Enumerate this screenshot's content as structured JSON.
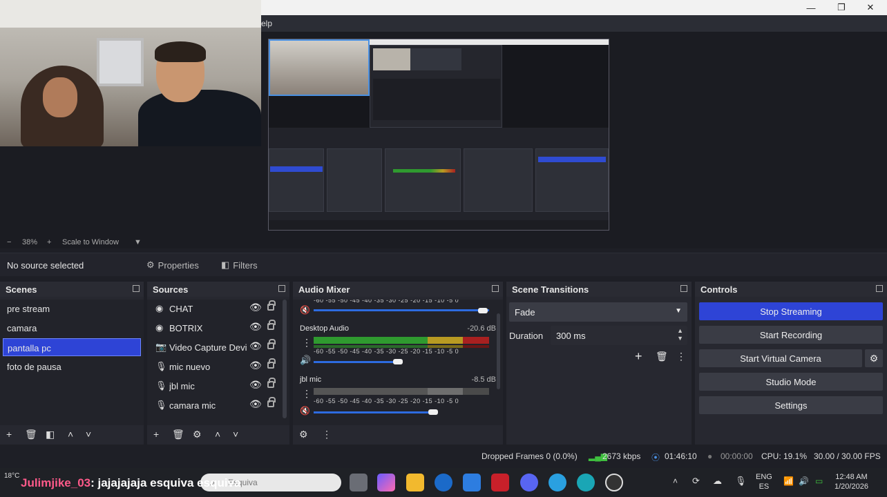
{
  "window": {
    "minimize": "—",
    "restore": "❐",
    "close": "✕",
    "menu_fragment": "elp"
  },
  "preview_toolbar": {
    "zoom_out": "−",
    "zoom": "38%",
    "zoom_in": "+",
    "scale_mode": "Scale to Window"
  },
  "source_toolbar": {
    "status": "No source selected",
    "properties": "Properties",
    "filters": "Filters"
  },
  "scenes": {
    "title": "Scenes",
    "items": [
      {
        "label": "pre stream"
      },
      {
        "label": "camara"
      },
      {
        "label": "pantalla pc"
      },
      {
        "label": "foto de pausa"
      }
    ],
    "selected": "pantalla pc"
  },
  "sources": {
    "title": "Sources",
    "items": [
      {
        "label": "CHAT",
        "icon": "browser-icon"
      },
      {
        "label": "BOTRIX",
        "icon": "browser-icon"
      },
      {
        "label": "Video Capture Device",
        "icon": "camera-icon"
      },
      {
        "label": "mic nuevo",
        "icon": "mic-icon"
      },
      {
        "label": "jbl mic",
        "icon": "mic-icon"
      },
      {
        "label": "camara mic",
        "icon": "mic-icon"
      }
    ]
  },
  "audio_mixer": {
    "title": "Audio Mixer",
    "scale": "-60 -55 -50 -45 -40 -35 -30 -25 -20 -15 -10 -5 0",
    "channels": [
      {
        "name": "Desktop Audio",
        "db": "-20.6 dB",
        "volume": 0.48
      },
      {
        "name": "jbl mic",
        "db": "-8.5 dB",
        "volume": 0.68
      }
    ]
  },
  "scene_transitions": {
    "title": "Scene Transitions",
    "transition": "Fade",
    "duration_label": "Duration",
    "duration_value": "300 ms"
  },
  "controls": {
    "title": "Controls",
    "stop_streaming": "Stop Streaming",
    "start_recording": "Start Recording",
    "start_virtual_camera": "Start Virtual Camera",
    "studio_mode": "Studio Mode",
    "settings": "Settings"
  },
  "status": {
    "dropped_frames": "Dropped Frames 0 (0.0%)",
    "bitrate": "2673 kbps",
    "stream_time": "01:46:10",
    "record_time": "00:00:00",
    "cpu": "CPU: 19.1%",
    "fps": "30.00 / 30.00 FPS"
  },
  "taskbar": {
    "weather": "18°C",
    "chat_user": "Julimjike_03",
    "chat_message": ": jajajajaja esquiva esquiva",
    "search_text": "Esquiva",
    "lang_line1": "ENG",
    "lang_line2": "ES",
    "time": "12:48 AM",
    "date": "1/20/2026"
  },
  "colors": {
    "accent": "#2e44d6",
    "panel": "#272830",
    "meter_green": "#2f9a2f",
    "meter_yellow": "#b89a22",
    "meter_red": "#a82020"
  }
}
